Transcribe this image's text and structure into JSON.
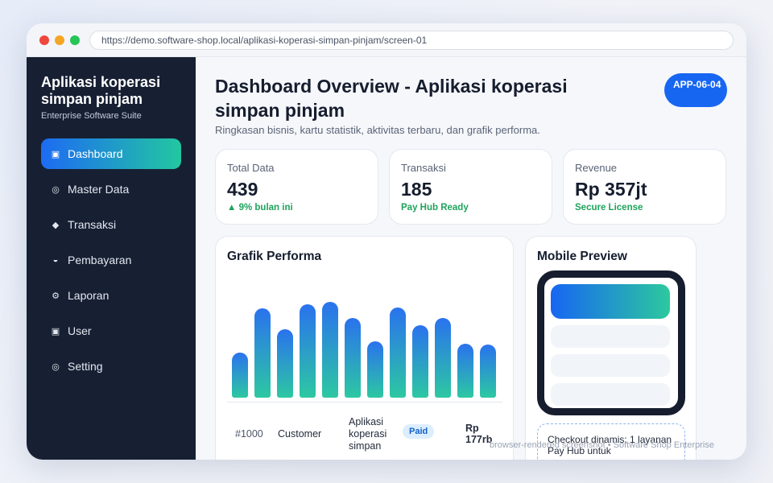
{
  "browser": {
    "url": "https://demo.software-shop.local/aplikasi-koperasi-simpan-pinjam/screen-01"
  },
  "colors": {
    "accent": "#1766f2",
    "teal": "#22c7a0",
    "sidebar": "#172033",
    "success": "#1ea35b"
  },
  "sidebar": {
    "brand": "Aplikasi koperasi simpan pinjam",
    "subtitle": "Enterprise Software Suite",
    "items": [
      {
        "label": "Dashboard",
        "icon": "▣",
        "active": true
      },
      {
        "label": "Master Data",
        "icon": "◎",
        "active": false
      },
      {
        "label": "Transaksi",
        "icon": "◆",
        "active": false
      },
      {
        "label": "Pembayaran",
        "icon": "◒",
        "active": false
      },
      {
        "label": "Laporan",
        "icon": "⚙",
        "active": false
      },
      {
        "label": "User",
        "icon": "▣",
        "active": false
      },
      {
        "label": "Setting",
        "icon": "◎",
        "active": false
      }
    ]
  },
  "header": {
    "title": "Dashboard Overview - Aplikasi koperasi simpan pinjam",
    "subtitle": "Ringkasan bisnis, kartu statistik, aktivitas terbaru, dan grafik performa.",
    "badge": "APP-06-04"
  },
  "stats": [
    {
      "label": "Total Data",
      "value": "439",
      "note": "▲ 9% bulan ini"
    },
    {
      "label": "Transaksi",
      "value": "185",
      "note": "Pay Hub Ready"
    },
    {
      "label": "Revenue",
      "value": "Rp 357jt",
      "note": "Secure License"
    }
  ],
  "performance": {
    "title": "Grafik Performa",
    "bars": [
      0.4,
      0.79,
      0.61,
      0.83,
      0.85,
      0.71,
      0.5,
      0.8,
      0.64,
      0.71,
      0.48,
      0.47
    ]
  },
  "activity": {
    "id": "#1000",
    "customer": "Customer",
    "product": "Aplikasi koperasi simpan",
    "status": "Paid",
    "amount": "Rp 177rb"
  },
  "mobile": {
    "title": "Mobile Preview",
    "checkout": "Checkout dinamis: 1 layanan Pay Hub untuk"
  },
  "footer": "browser-rendered screenshot • Software Shop Enterprise"
}
